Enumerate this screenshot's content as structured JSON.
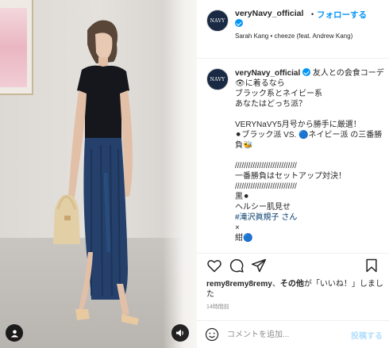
{
  "post": {
    "username": "veryNavy_official",
    "avatar_text": "NAVY",
    "follow_label": "フォローする",
    "separator": "•",
    "music": "Sarah Kang • cheeze (feat. Andrew Kang)",
    "verified_icon": "verified-badge-icon"
  },
  "caption": {
    "username": "veryNavy_official",
    "lines": [
      "友人との会食コーデ👁に着るなら",
      "ブラック系とネイビー系",
      "あなたはどっち派？",
      "",
      "VERYNaVY5月号から勝手に厳選！",
      "⚫ブラック派 VS. 🔵ネイビー派 の三番勝負🐝",
      "",
      "////////////////////////////",
      "一番勝負はセットアップ対決！",
      "////////////////////////////",
      "黒⚫",
      "ヘルシー肌見せ",
      "#滝沢眞規子 さん",
      "×",
      "紺🔵"
    ],
    "hashtag": "#滝沢眞規子"
  },
  "actions": {
    "like_icon": "heart-icon",
    "comment_icon": "comment-icon",
    "share_icon": "share-icon",
    "save_icon": "bookmark-icon"
  },
  "likes": {
    "user": "remy8remy8remy",
    "middle": "、",
    "others": "その他",
    "suffix": "が「いいね！」しました"
  },
  "time_ago": "14時間前",
  "comment": {
    "placeholder": "コメントを追加...",
    "post_label": "投稿する"
  },
  "colors": {
    "accent": "#0095f6",
    "post_disabled": "#b2dffc",
    "text": "#262626",
    "muted": "#8e8e8e"
  }
}
